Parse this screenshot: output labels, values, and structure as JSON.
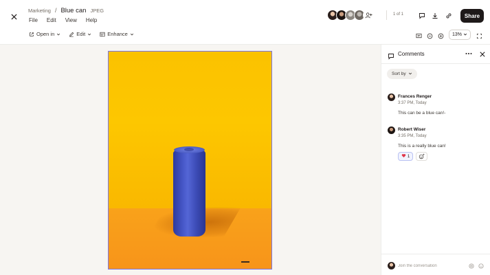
{
  "header": {
    "folder": "Marketing",
    "separator": "/",
    "file_name": "Blue can",
    "file_type": "JPEG",
    "menu": [
      "File",
      "Edit",
      "View",
      "Help"
    ],
    "page_count": "1 of 1",
    "share_label": "Share"
  },
  "toolbar": {
    "open_in": "Open in",
    "edit": "Edit",
    "enhance": "Enhance",
    "zoom": "13%"
  },
  "panel": {
    "title": "Comments",
    "sort_label": "Sort by",
    "comments": [
      {
        "author": "Frances Renger",
        "time": "3:37 PM, Today",
        "text": "This can be a blue can!-"
      },
      {
        "author": "Robert Wiser",
        "time": "3:35 PM, Today",
        "text": "This is a really blue can!",
        "reaction_count": "1"
      }
    ],
    "join_placeholder": "Join the conversation"
  },
  "colors": {
    "accent": "#7b74e6",
    "share_bg": "#1e1919",
    "canvas_bg": "#f7f5f2",
    "image_wall": "#fdc700",
    "image_floor": "#f7941a",
    "can_blue": "#4657c8"
  },
  "icons": [
    "close-icon",
    "open-in-icon",
    "pencil-icon",
    "enhance-icon",
    "chevron-down-icon",
    "comment-icon",
    "download-icon",
    "link-icon",
    "present-icon",
    "minus-circle-icon",
    "plus-circle-icon",
    "fullscreen-icon",
    "more-icon",
    "heart-icon",
    "add-reaction-icon",
    "emoji-icon",
    "mention-icon"
  ]
}
